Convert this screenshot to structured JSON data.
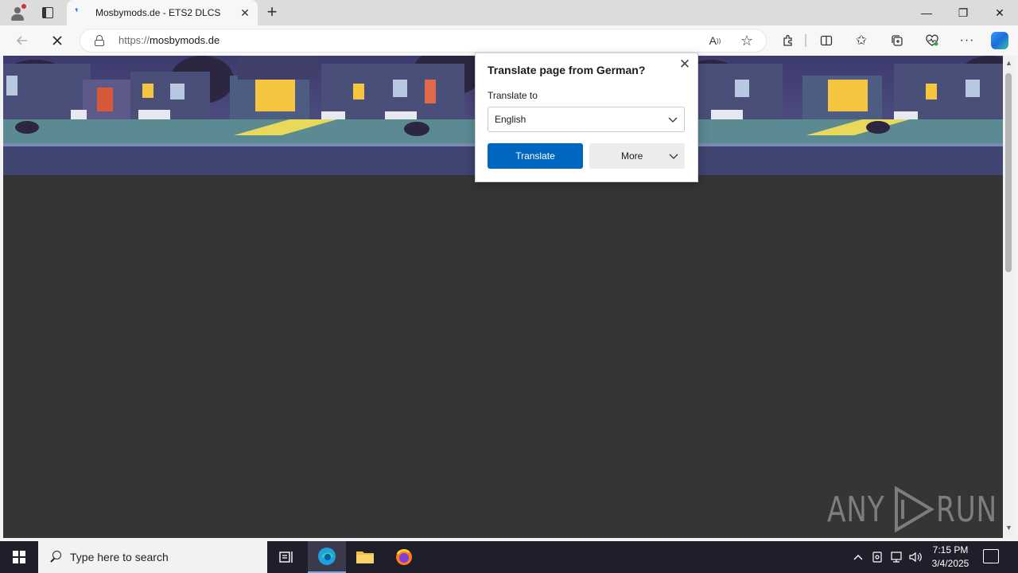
{
  "tabstrip": {
    "tab_title": "Mosbymods.de - ETS2 DLCS",
    "new_tab_label": "+",
    "window_controls": {
      "minimize": "—",
      "restore": "❐",
      "close": "✕"
    }
  },
  "addressbar": {
    "url_protocol": "https://",
    "url_host": "mosbymods.de"
  },
  "translate_popup": {
    "title": "Translate page from German?",
    "translate_to_label": "Translate to",
    "selected_language": "English",
    "translate_button": "Translate",
    "more_button": "More"
  },
  "watermark": {
    "left": "ANY",
    "right": "RUN"
  },
  "taskbar": {
    "search_placeholder": "Type here to search",
    "time": "7:15 PM",
    "date": "3/4/2025"
  },
  "colors": {
    "accent_blue": "#0067c0",
    "page_background": "#353535",
    "taskbar": "#1f1f2b"
  },
  "icons": {
    "profile": "profile-icon",
    "tabs": "tab-actions-icon",
    "back": "back-arrow-icon",
    "stop": "stop-loading-icon",
    "lock": "lock-icon",
    "read_aloud": "read-aloud-icon",
    "favorite": "star-icon",
    "extensions": "puzzle-icon",
    "split": "split-screen-icon",
    "favorites": "favorites-icon",
    "collections": "collections-icon",
    "performance": "heart-pulse-icon",
    "more": "ellipsis-icon",
    "copilot": "copilot-icon"
  }
}
